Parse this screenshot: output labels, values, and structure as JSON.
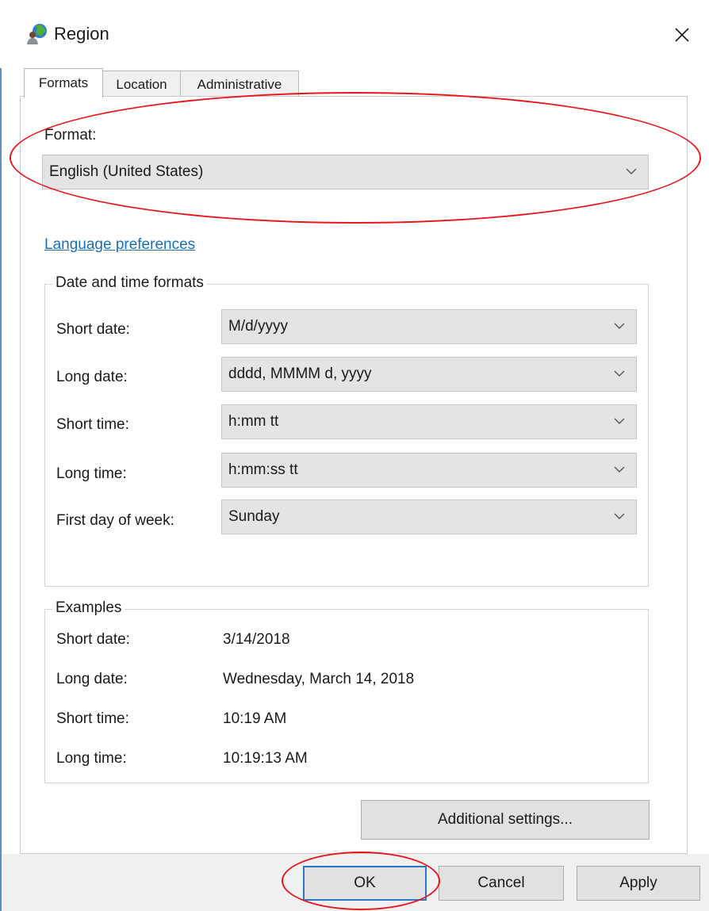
{
  "window": {
    "title": "Region",
    "icon": "globe-user-icon",
    "close_icon": "close-icon"
  },
  "tabs": [
    {
      "label": "Formats",
      "active": true
    },
    {
      "label": "Location",
      "active": false
    },
    {
      "label": "Administrative",
      "active": false
    }
  ],
  "format": {
    "label": "Format:",
    "value": "English (United States)"
  },
  "language_link": "Language preferences",
  "date_time": {
    "title": "Date and time formats",
    "rows": [
      {
        "label": "Short date:",
        "value": "M/d/yyyy"
      },
      {
        "label": "Long date:",
        "value": "dddd, MMMM d, yyyy"
      },
      {
        "label": "Short time:",
        "value": "h:mm tt"
      },
      {
        "label": "Long time:",
        "value": "h:mm:ss tt"
      },
      {
        "label": "First day of week:",
        "value": "Sunday"
      }
    ]
  },
  "examples": {
    "title": "Examples",
    "rows": [
      {
        "label": "Short date:",
        "value": "3/14/2018"
      },
      {
        "label": "Long date:",
        "value": "Wednesday, March 14, 2018"
      },
      {
        "label": "Short time:",
        "value": "10:19 AM"
      },
      {
        "label": "Long time:",
        "value": "10:19:13 AM"
      }
    ]
  },
  "buttons": {
    "additional": "Additional settings...",
    "ok": "OK",
    "cancel": "Cancel",
    "apply": "Apply"
  },
  "colors": {
    "annotation": "#e8161b",
    "link": "#1a6fb3",
    "default_button_border": "#2b78c8"
  }
}
